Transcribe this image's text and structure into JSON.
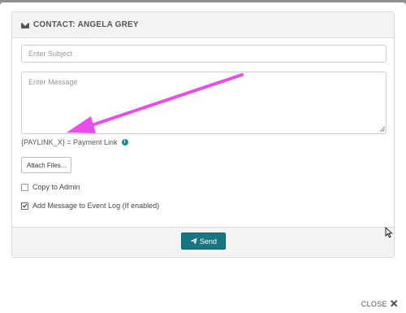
{
  "backdrop": {
    "text": "CLOSE X"
  },
  "header": {
    "title": "CONTACT: ANGELA GREY",
    "icon": "envelope-icon"
  },
  "form": {
    "subject_placeholder": "Enter Subject",
    "message_placeholder": "Enter Message",
    "paylink_text": "{PAYLINK_X} = Payment Link",
    "attach_label": "Attach Files...",
    "copy_admin_label": "Copy to Admin",
    "copy_admin_checked": false,
    "event_log_label": "Add Message to Event Log (If enabled)",
    "event_log_checked": true
  },
  "footer": {
    "send_label": "Send"
  },
  "close": {
    "label": "CLOSE"
  },
  "colors": {
    "accent": "#187583",
    "annotation": "#e84ee8",
    "info": "#1a8a93"
  }
}
